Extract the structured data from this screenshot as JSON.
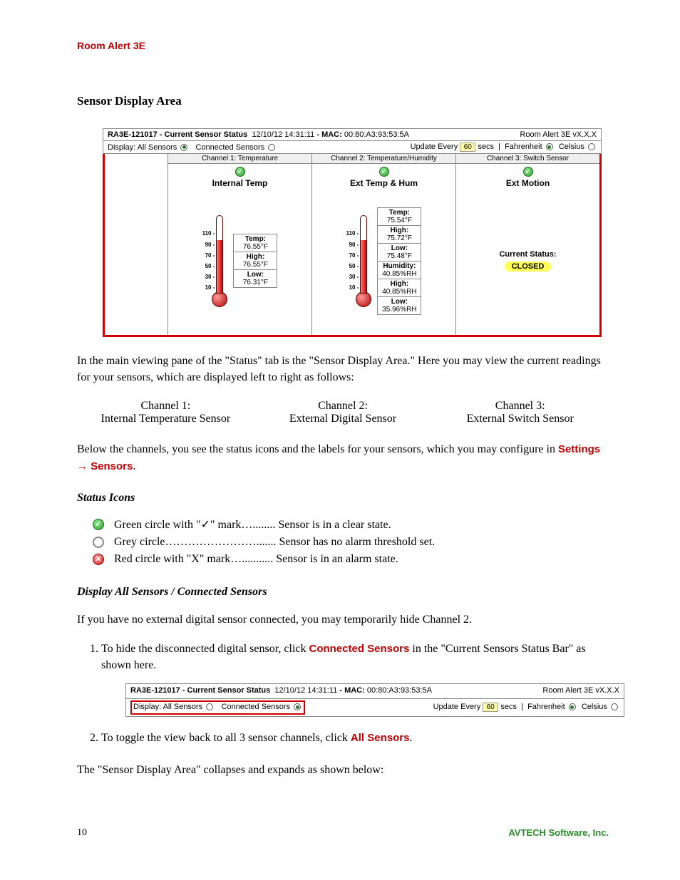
{
  "header": {
    "product": "Room Alert 3E"
  },
  "section": {
    "title": "Sensor Display Area"
  },
  "panel": {
    "device_id": "RA3E-121017",
    "status_label": "Current Sensor Status",
    "datetime": "12/10/12 14:31:11",
    "mac_label": "MAC:",
    "mac": "00:80:A3:93:53:5A",
    "model": "Room Alert 3E vX.X.X",
    "opts": {
      "display_label": "Display:",
      "all_sensors": "All Sensors",
      "connected_sensors": "Connected Sensors",
      "update_label": "Update Every",
      "update_value": "60",
      "update_unit": "secs",
      "fahrenheit": "Fahrenheit",
      "celsius": "Celsius"
    },
    "ch1": {
      "head": "Channel 1: Temperature",
      "title": "Internal Temp",
      "scale": [
        "110 -",
        "90 -",
        "70 -",
        "50 -",
        "30 -",
        "10 -"
      ],
      "rows": [
        {
          "lbl": "Temp:",
          "val": "76.55°F"
        },
        {
          "lbl": "High:",
          "val": "76.55°F"
        },
        {
          "lbl": "Low:",
          "val": "76.31°F"
        }
      ]
    },
    "ch2": {
      "head": "Channel 2: Temperature/Humidity",
      "title": "Ext Temp & Hum",
      "scale": [
        "110 -",
        "90 -",
        "70 -",
        "50 -",
        "30 -",
        "10 -"
      ],
      "rows": [
        {
          "lbl": "Temp:",
          "val": "75.54°F"
        },
        {
          "lbl": "High:",
          "val": "75.72°F"
        },
        {
          "lbl": "Low:",
          "val": "75.48°F"
        },
        {
          "lbl": "Humidity:",
          "val": "40.85%RH"
        },
        {
          "lbl": "High:",
          "val": "40.85%RH"
        },
        {
          "lbl": "Low:",
          "val": "35.96%RH"
        }
      ]
    },
    "ch3": {
      "head": "Channel 3: Switch Sensor",
      "title": "Ext Motion",
      "status_label": "Current Status:",
      "status_value": "CLOSED"
    }
  },
  "intro": "In the main viewing pane of the \"Status\" tab is the \"Sensor Display Area.\" Here you may view the current readings for your sensors, which are displayed left to right as follows:",
  "channels": {
    "c1a": "Channel 1:",
    "c1b": "Internal Temperature Sensor",
    "c2a": "Channel 2:",
    "c2b": "External Digital Sensor",
    "c3a": "Channel 3:",
    "c3b": "External Switch Sensor"
  },
  "below_text_a": "Below the channels, you see the status icons and the labels for your sensors, which you may configure in ",
  "below_text_settings": "Settings",
  "below_text_arrow": " → ",
  "below_text_sensors": "Sensors",
  "below_text_period": ".",
  "status_icons_title": "Status Icons",
  "status_items": {
    "green_a": "Green circle with \"",
    "green_check": "✓",
    "green_b": "\" mark…........ Sensor is in a clear state.",
    "grey": "Grey circle……………………....... Sensor has no alarm threshold set.",
    "red": "Red circle with \"X\" mark…........... Sensor is in an alarm state."
  },
  "display_title": "Display All Sensors / Connected Sensors",
  "display_intro": "If you have no external digital sensor connected, you may temporarily hide Channel 2.",
  "steps": {
    "s1a": "To hide the disconnected digital sensor, click ",
    "s1b": "Connected Sensors",
    "s1c": " in the \"Current Sensors Status Bar\" as shown here.",
    "s2a": "To toggle the view back to all 3 sensor channels, click ",
    "s2b": "All Sensors",
    "s2c": "."
  },
  "closing": "The \"Sensor Display Area\" collapses and expands as shown below:",
  "footer": {
    "page": "10",
    "company": "AVTECH Software, Inc."
  }
}
